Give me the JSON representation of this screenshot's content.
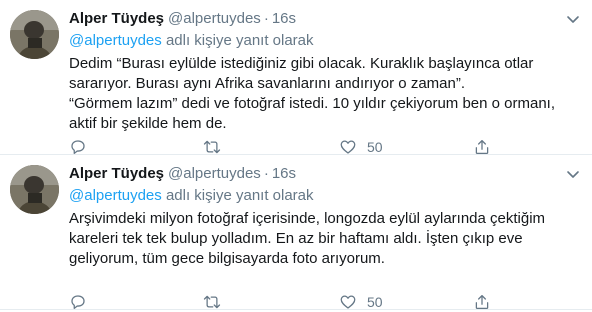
{
  "tweets": [
    {
      "name": "Alper Tüydeş",
      "handle": "@alpertuydes",
      "separator": "·",
      "time": "16s",
      "reply_mention": "@alpertuydes",
      "reply_suffix": " adlı kişiye yanıt olarak",
      "paragraphs": [
        "Dedim “Burası eylülde istediğiniz gibi olacak. Kuraklık başlayınca otlar sararıyor. Burası aynı Afrika savanlarını andırıyor o zaman”.",
        "“Görmem lazım” dedi ve fotoğraf istedi. 10 yıldır çekiyorum ben o ormanı, aktif bir şekilde hem de."
      ],
      "like_count": "50"
    },
    {
      "name": "Alper Tüydeş",
      "handle": "@alpertuydes",
      "separator": "·",
      "time": "16s",
      "reply_mention": "@alpertuydes",
      "reply_suffix": " adlı kişiye yanıt olarak",
      "paragraphs": [
        "Arşivimdeki milyon fotoğraf içerisinde, longozda eylül aylarında çektiğim kareleri tek tek bulup yolladım. En az bir haftamı aldı. İşten çıkıp eve geliyorum, tüm gece bilgisayarda foto arıyorum."
      ],
      "like_count": "50"
    }
  ],
  "icons": {
    "reply": "reply-icon",
    "retweet": "retweet-icon",
    "like": "heart-icon",
    "share": "share-icon",
    "more": "chevron-down-icon"
  },
  "colors": {
    "link": "#1da1f2",
    "muted": "#657786",
    "text": "#14171a"
  }
}
